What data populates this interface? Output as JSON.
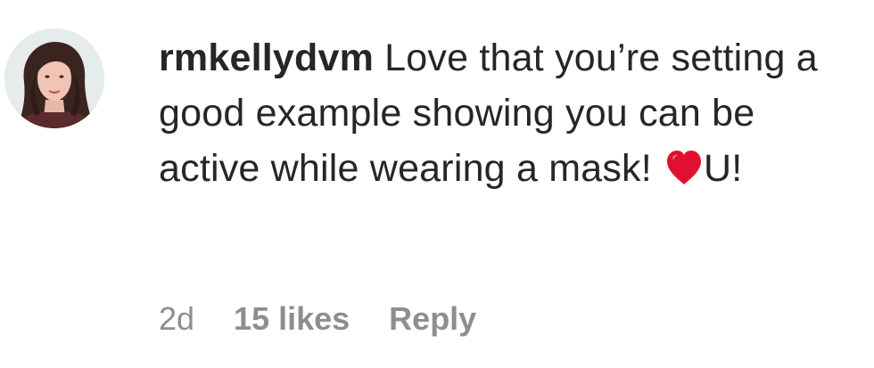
{
  "comment": {
    "username": "rmkellydvm",
    "text_before_emoji": " Love that you’re setting a good example showing you can be active while wearing a mask! ",
    "emoji_icon": "red-heart-icon",
    "text_after_emoji": "U!",
    "time": "2d",
    "likes": "15 likes",
    "reply_label": "Reply"
  },
  "colors": {
    "text_primary": "#262626",
    "text_secondary": "#8e8e8e",
    "heart": "#e0102e"
  }
}
